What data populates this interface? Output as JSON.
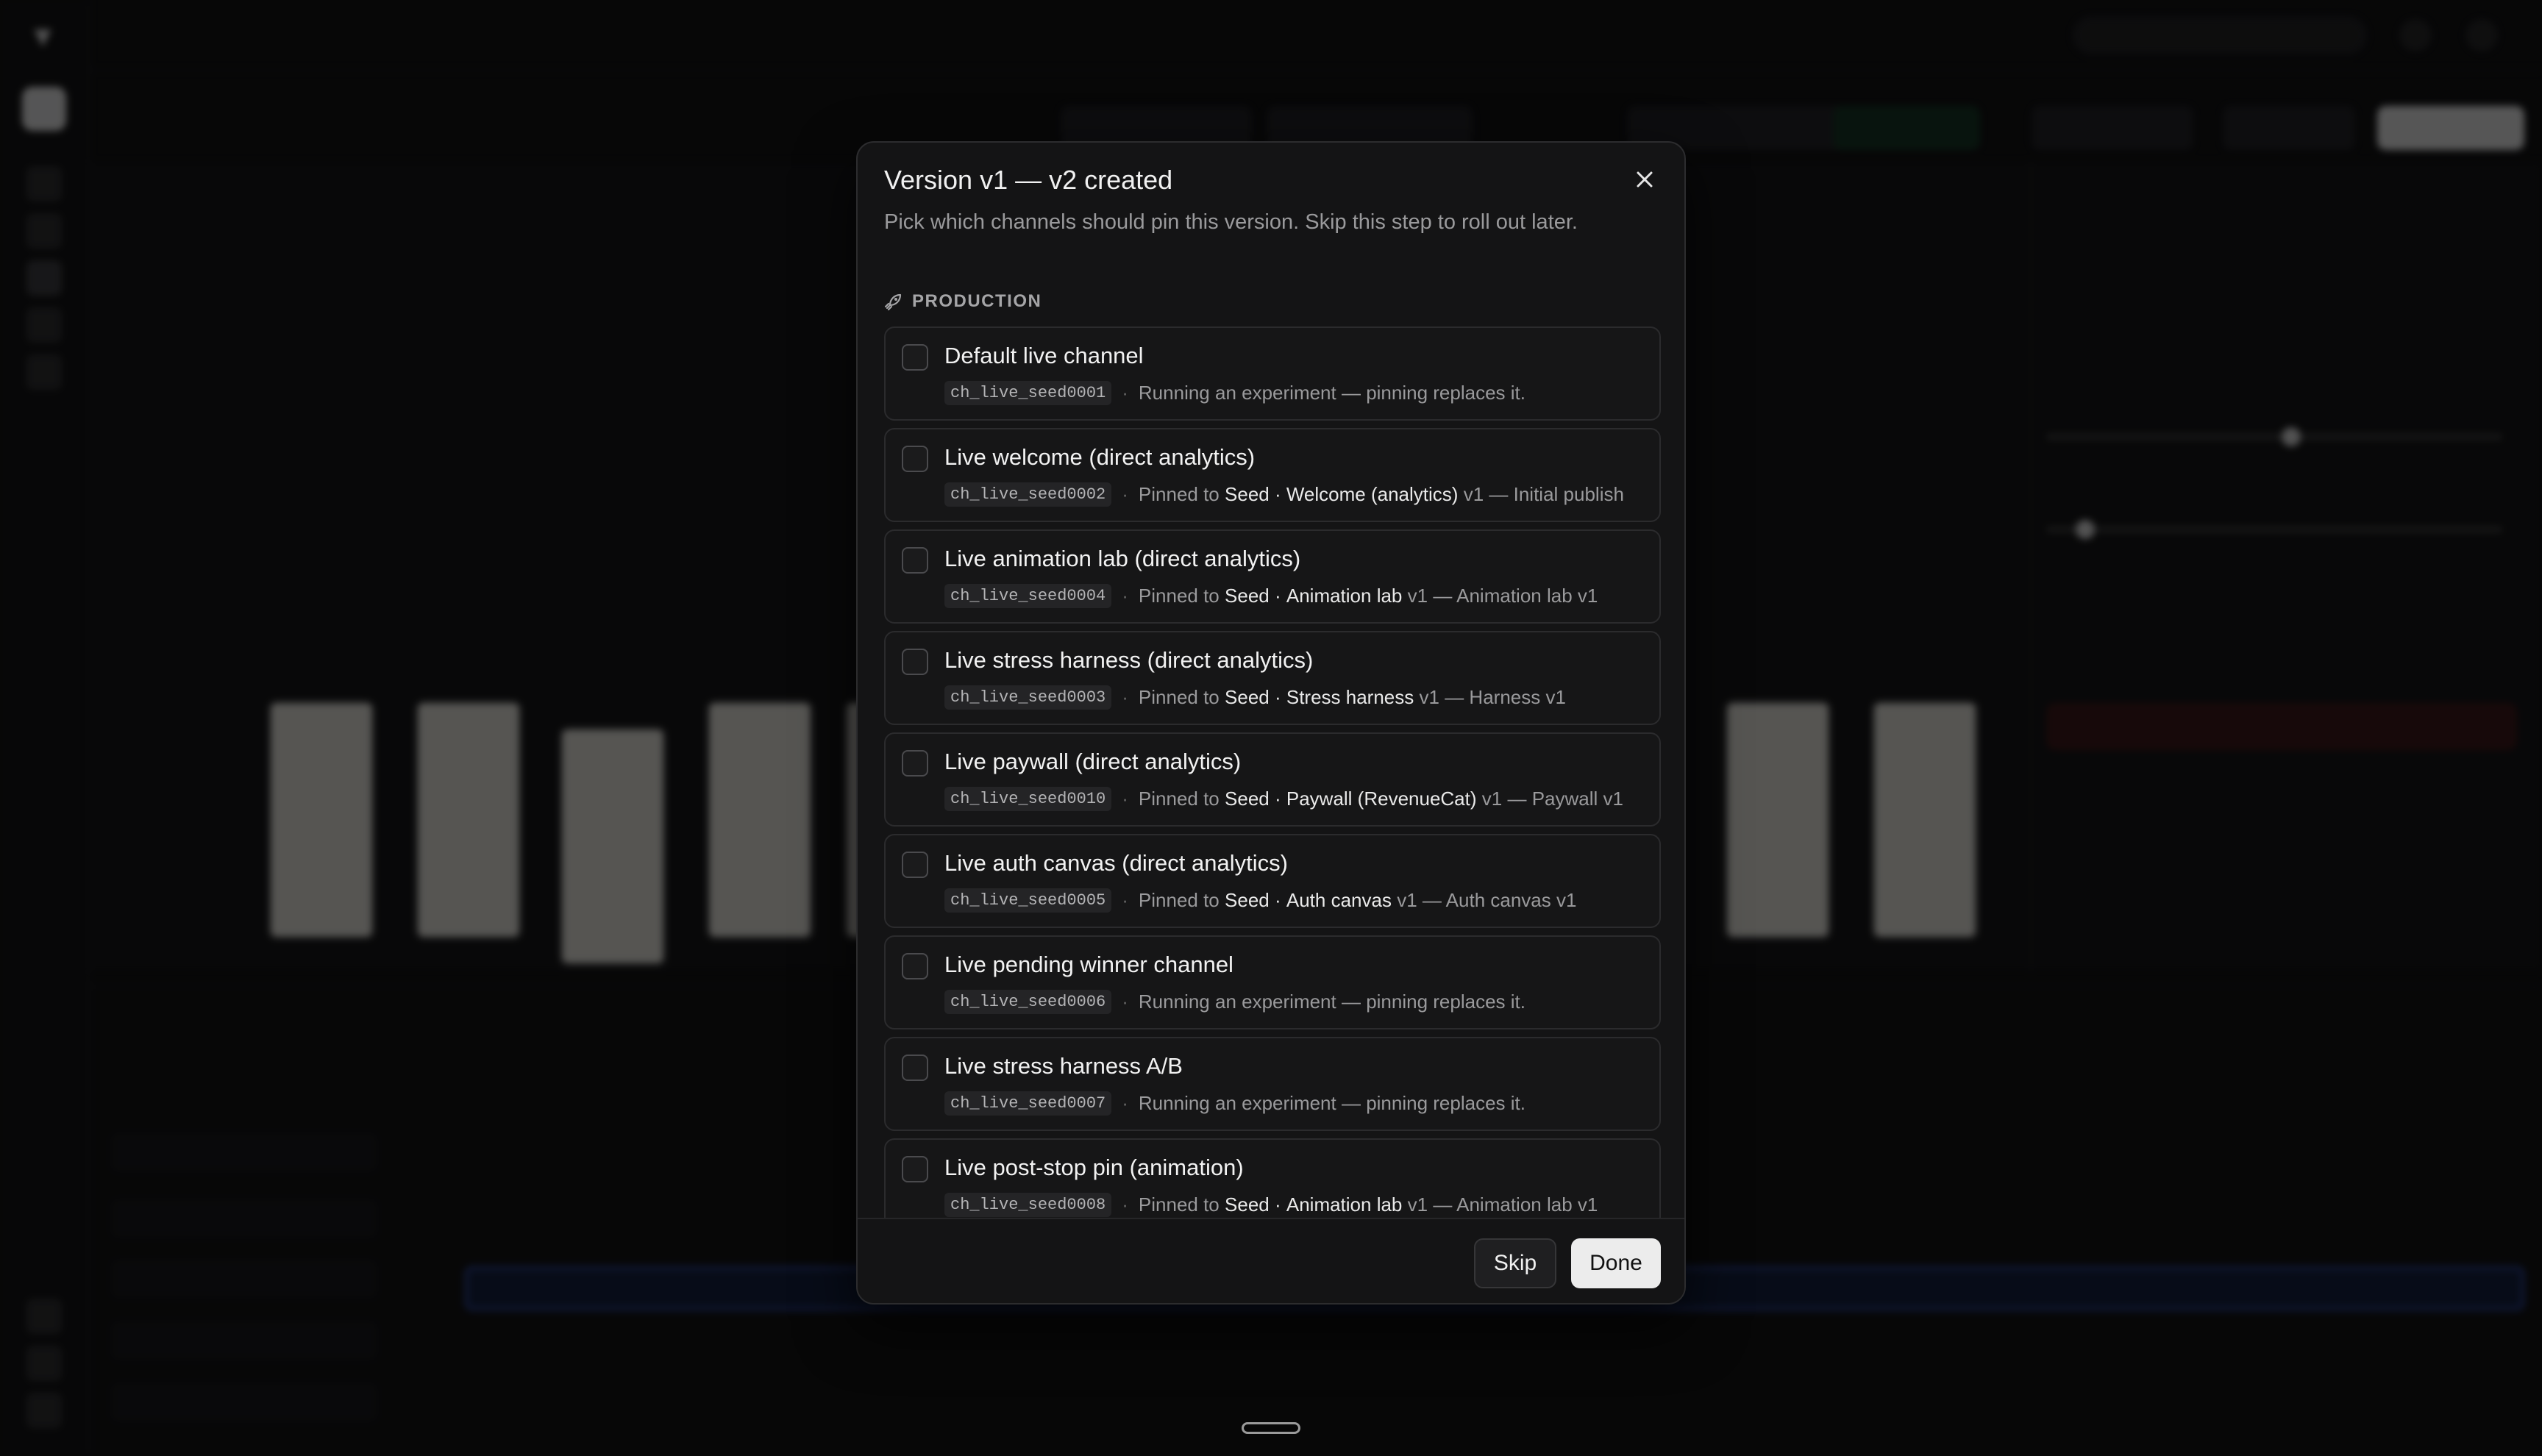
{
  "modal": {
    "title": "Version v1 — v2 created",
    "description": "Pick which channels should pin this version. Skip this step to roll out later.",
    "section_label": "PRODUCTION",
    "channels": [
      {
        "name": "Default live channel",
        "id": "ch_live_seed0001",
        "status": "Running an experiment — pinning replaces it."
      },
      {
        "name": "Live welcome (direct analytics)",
        "id": "ch_live_seed0002",
        "pinned_prefix": "Pinned to",
        "project": "Seed",
        "flow": "Welcome (analytics)",
        "version": "v1",
        "note": "— Initial publish"
      },
      {
        "name": "Live animation lab (direct analytics)",
        "id": "ch_live_seed0004",
        "pinned_prefix": "Pinned to",
        "project": "Seed",
        "flow": "Animation lab",
        "version": "v1",
        "note": "— Animation lab v1"
      },
      {
        "name": "Live stress harness (direct analytics)",
        "id": "ch_live_seed0003",
        "pinned_prefix": "Pinned to",
        "project": "Seed",
        "flow": "Stress harness",
        "version": "v1",
        "note": "— Harness v1"
      },
      {
        "name": "Live paywall (direct analytics)",
        "id": "ch_live_seed0010",
        "pinned_prefix": "Pinned to",
        "project": "Seed",
        "flow": "Paywall (RevenueCat)",
        "version": "v1",
        "note": "— Paywall v1"
      },
      {
        "name": "Live auth canvas (direct analytics)",
        "id": "ch_live_seed0005",
        "pinned_prefix": "Pinned to",
        "project": "Seed",
        "flow": "Auth canvas",
        "version": "v1",
        "note": "— Auth canvas v1"
      },
      {
        "name": "Live pending winner channel",
        "id": "ch_live_seed0006",
        "status": "Running an experiment — pinning replaces it."
      },
      {
        "name": "Live stress harness A/B",
        "id": "ch_live_seed0007",
        "status": "Running an experiment — pinning replaces it."
      },
      {
        "name": "Live post-stop pin (animation)",
        "id": "ch_live_seed0008",
        "pinned_prefix": "Pinned to",
        "project": "Seed",
        "flow": "Animation lab",
        "version": "v1",
        "note": "— Animation lab v1"
      }
    ],
    "skip_label": "Skip",
    "done_label": "Done"
  },
  "icons": {
    "close": "close-icon",
    "section": "rocket-icon",
    "checkbox": "checkbox-unchecked"
  },
  "colors": {
    "modal_bg": "#141415",
    "primary_button": "#ececec",
    "accent_track": "#2c4ab0"
  }
}
